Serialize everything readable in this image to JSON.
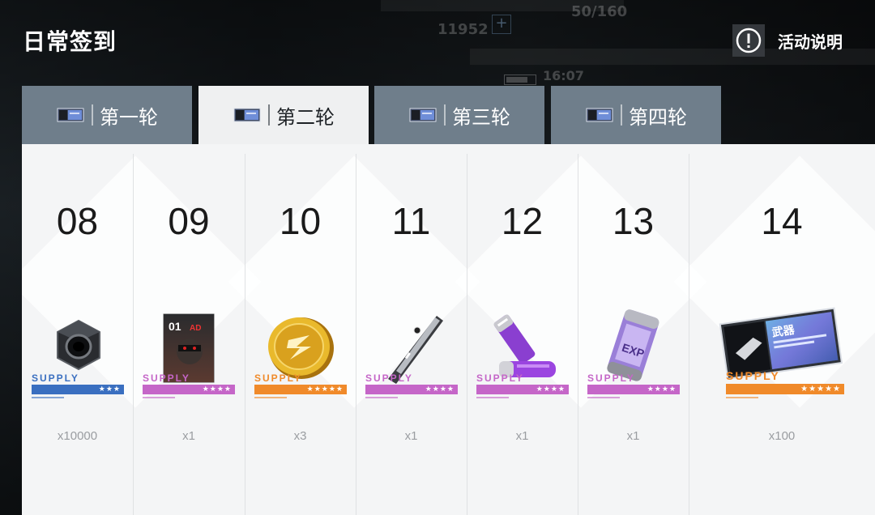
{
  "header": {
    "title": "日常签到",
    "info_label": "活动说明"
  },
  "background": {
    "currency": "11952",
    "stamina": "50/160",
    "time": "16:07"
  },
  "tabs": [
    {
      "label": "第一轮",
      "active": false
    },
    {
      "label": "第二轮",
      "active": true
    },
    {
      "label": "第三轮",
      "active": false
    },
    {
      "label": "第四轮",
      "active": false
    }
  ],
  "days": [
    {
      "day": "08",
      "item": "hex-nut-icon",
      "supply": "SUPPLY",
      "rarity": 3,
      "stars": "★★★",
      "color": "#3a6fc0",
      "qty": "x10000"
    },
    {
      "day": "09",
      "item": "character-card-icon",
      "supply": "SUPPLY",
      "rarity": 4,
      "stars": "★★★★",
      "color": "#c566c8",
      "qty": "x1"
    },
    {
      "day": "10",
      "item": "gold-coin-icon",
      "supply": "SUPPLY",
      "rarity": 5,
      "stars": "★★★★★",
      "color": "#f08a2a",
      "qty": "x3"
    },
    {
      "day": "11",
      "item": "metal-rod-icon",
      "supply": "SUPPLY",
      "rarity": 4,
      "stars": "★★★★",
      "color": "#c566c8",
      "qty": "x1"
    },
    {
      "day": "12",
      "item": "battery-cells-icon",
      "supply": "SUPPLY",
      "rarity": 4,
      "stars": "★★★★",
      "color": "#c566c8",
      "qty": "x1"
    },
    {
      "day": "13",
      "item": "exp-canister-icon",
      "supply": "SUPPLY",
      "rarity": 4,
      "stars": "★★★★",
      "color": "#c566c8",
      "qty": "x1"
    },
    {
      "day": "14",
      "item": "weapon-ticket-icon",
      "supply": "SUPPLY",
      "rarity": 5,
      "stars": "★★★★★",
      "color": "#f08a2a",
      "qty": "x100",
      "card_text": "武器"
    }
  ],
  "colors": {
    "tab_inactive": "#6f7e8b",
    "tab_active": "#eff0f1",
    "panel": "#f4f5f6"
  }
}
